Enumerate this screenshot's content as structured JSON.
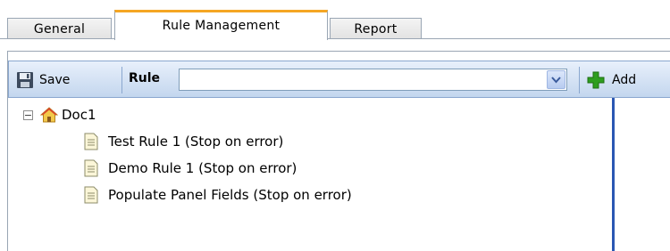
{
  "tabs": [
    {
      "label": "General",
      "active": false
    },
    {
      "label": "Rule Management",
      "active": true
    },
    {
      "label": "Report",
      "active": false
    }
  ],
  "toolbar": {
    "save_label": "Save",
    "rule_label": "Rule",
    "rule_select_value": "",
    "add_label": "Add"
  },
  "tree": {
    "root": {
      "label": "Doc1",
      "expanded": true,
      "icon": "home-icon"
    },
    "children": [
      {
        "label": "Test Rule 1 (Stop on error)",
        "icon": "document-icon"
      },
      {
        "label": "Demo Rule 1 (Stop on error)",
        "icon": "document-icon"
      },
      {
        "label": "Populate Panel Fields (Stop on error)",
        "icon": "document-icon"
      }
    ]
  },
  "colors": {
    "active_tab_accent": "#f5a623",
    "toolbar_gradient_top": "#e8f0fb",
    "toolbar_gradient_bottom": "#c3d6ee",
    "splitter": "#2a57b3",
    "add_icon": "#2e9e1f"
  }
}
